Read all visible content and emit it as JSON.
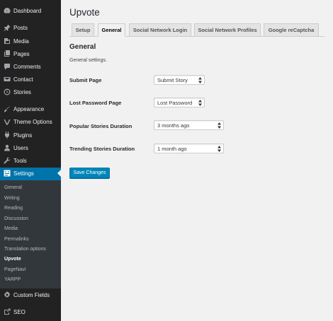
{
  "sidebar": {
    "items": [
      {
        "label": "Dashboard",
        "icon": "dashboard-icon"
      },
      {
        "label": "Posts",
        "icon": "pin-icon"
      },
      {
        "label": "Media",
        "icon": "media-icon"
      },
      {
        "label": "Pages",
        "icon": "pages-icon"
      },
      {
        "label": "Comments",
        "icon": "comments-icon"
      },
      {
        "label": "Contact",
        "icon": "mail-icon"
      },
      {
        "label": "Stories",
        "icon": "clock-icon"
      },
      {
        "label": "Appearance",
        "icon": "brush-icon"
      },
      {
        "label": "Theme Options",
        "icon": "star-icon"
      },
      {
        "label": "Plugins",
        "icon": "plug-icon"
      },
      {
        "label": "Users",
        "icon": "users-icon"
      },
      {
        "label": "Tools",
        "icon": "wrench-icon"
      },
      {
        "label": "Settings",
        "icon": "settings-icon"
      },
      {
        "label": "Custom Fields",
        "icon": "gear-icon"
      },
      {
        "label": "SEO",
        "icon": "seo-icon"
      }
    ],
    "submenu": [
      "General",
      "Writing",
      "Reading",
      "Discussion",
      "Media",
      "Permalinks",
      "Translation options",
      "Upvote",
      "PageNavi",
      "YARPP"
    ],
    "active_item": "Settings",
    "current_submenu": "Upvote",
    "active_color": "#0073aa"
  },
  "page": {
    "title": "Upvote",
    "tabs": [
      "Setup",
      "General",
      "Social Network Login",
      "Social Network Profiles",
      "Google reCaptcha"
    ],
    "active_tab": "General",
    "section_title": "General",
    "section_desc": "General settings.",
    "fields": [
      {
        "label": "Submit Page",
        "value": "Submit Story"
      },
      {
        "label": "Lost Password Page",
        "value": "Lost Password"
      },
      {
        "label": "Popular Stories Duration",
        "value": "3 months ago"
      },
      {
        "label": "Trending Stories Duration",
        "value": "1 month ago"
      }
    ],
    "save_label": "Save Changes",
    "button_color": "#0085ba"
  }
}
